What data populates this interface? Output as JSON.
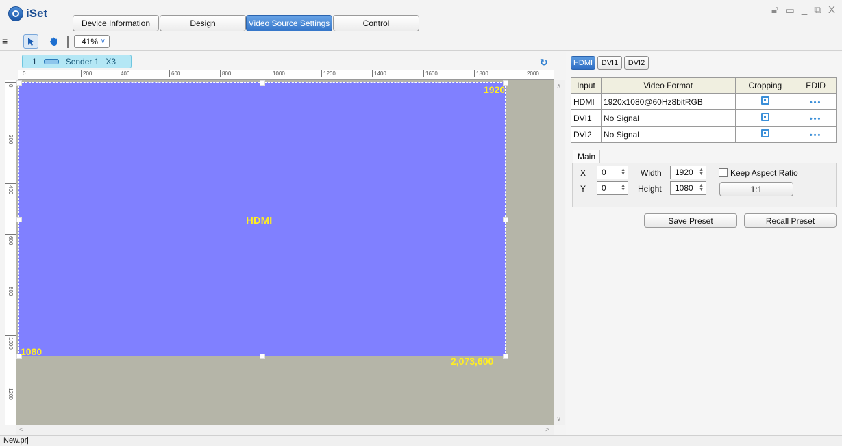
{
  "app": {
    "logo_text": "iSet",
    "project_file": "New.prj"
  },
  "nav": {
    "tabs": [
      {
        "label": "Device Information"
      },
      {
        "label": "Design"
      },
      {
        "label": "Video Source Settings",
        "active": true
      },
      {
        "label": "Control"
      }
    ]
  },
  "window_controls": {
    "lock_icon": "lock-icon",
    "monitor_icon": "monitor-icon",
    "minimize": "_",
    "restore_icon": "restore-icon",
    "close": "X"
  },
  "toolbar": {
    "zoom": "41%"
  },
  "sender": {
    "index": "1",
    "name": "Sender 1",
    "model": "X3"
  },
  "ruler": {
    "h_ticks": [
      "0",
      "200",
      "400",
      "600",
      "800",
      "1000",
      "1200",
      "1400",
      "1600",
      "1800",
      "2000"
    ],
    "v_ticks": [
      "0",
      "200",
      "400",
      "600",
      "800",
      "1000",
      "1200"
    ]
  },
  "canvas": {
    "layer_label": "HDMI",
    "width_label": "1920",
    "height_label": "1080",
    "pixels_label": "2,073,600",
    "layer_color": "#8080ff",
    "background_color": "#b5b5a8"
  },
  "source_tabs": [
    {
      "label": "HDMI",
      "active": true
    },
    {
      "label": "DVI1"
    },
    {
      "label": "DVI2"
    }
  ],
  "table": {
    "headers": {
      "input": "Input",
      "video_format": "Video Format",
      "cropping": "Cropping",
      "edid": "EDID"
    },
    "rows": [
      {
        "input": "HDMI",
        "format": "1920x1080@60Hz8bitRGB",
        "edid": "•••"
      },
      {
        "input": "DVI1",
        "format": "No Signal",
        "edid": "•••"
      },
      {
        "input": "DVI2",
        "format": "No Signal",
        "edid": "•••"
      }
    ]
  },
  "main": {
    "tab_label": "Main",
    "x_label": "X",
    "y_label": "Y",
    "width_label": "Width",
    "height_label": "Height",
    "x_value": "0",
    "y_value": "0",
    "width_value": "1920",
    "height_value": "1080",
    "keep_aspect_label": "Keep Aspect Ratio",
    "keep_aspect_checked": false,
    "ratio_button": "1:1"
  },
  "presets": {
    "save": "Save Preset",
    "recall": "Recall Preset"
  }
}
